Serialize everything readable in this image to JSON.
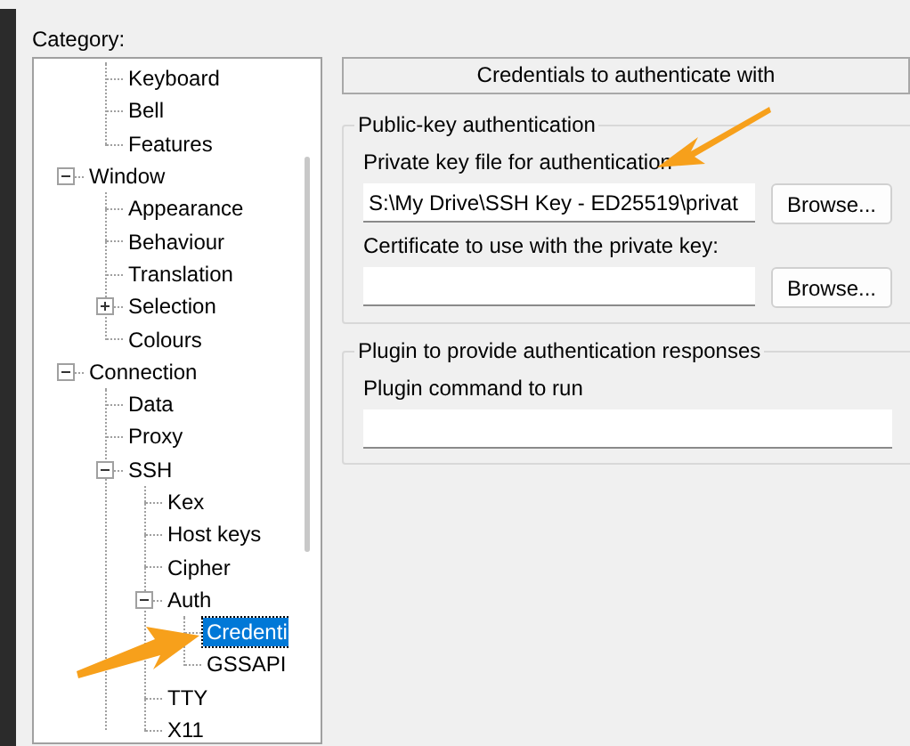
{
  "category_label": "Category:",
  "tree": {
    "items": [
      {
        "children": [
          {
            "label": "Keyboard",
            "selected": false
          },
          {
            "label": "Bell",
            "selected": false
          },
          {
            "label": "Features",
            "selected": false
          }
        ]
      },
      {
        "label": "Window",
        "selected": false,
        "expanded": true,
        "children": [
          {
            "label": "Appearance",
            "selected": false
          },
          {
            "label": "Behaviour",
            "selected": false
          },
          {
            "label": "Translation",
            "selected": false
          },
          {
            "label": "Selection",
            "selected": false,
            "expanded": false
          },
          {
            "label": "Colours",
            "selected": false
          }
        ]
      },
      {
        "label": "Connection",
        "selected": false,
        "expanded": true,
        "children": [
          {
            "label": "Data",
            "selected": false
          },
          {
            "label": "Proxy",
            "selected": false
          },
          {
            "label": "SSH",
            "selected": false,
            "expanded": true,
            "children": [
              {
                "label": "Kex",
                "selected": false
              },
              {
                "label": "Host keys",
                "selected": false
              },
              {
                "label": "Cipher",
                "selected": false
              },
              {
                "label": "Auth",
                "selected": false,
                "expanded": true,
                "children": [
                  {
                    "label": "Credenti",
                    "selected": true
                  },
                  {
                    "label": "GSSAPI",
                    "selected": false
                  }
                ]
              },
              {
                "label": "TTY",
                "selected": false
              },
              {
                "label": "X11",
                "selected": false
              }
            ]
          }
        ]
      }
    ]
  },
  "panel_title": "Credentials to authenticate with",
  "groups": [
    {
      "title": "Public-key authentication",
      "fields": [
        {
          "label": "Private key file for authentication",
          "value": "S:\\My Drive\\SSH Key - ED25519\\privat",
          "button": "Browse..."
        },
        {
          "label": "Certificate to use with the private key:",
          "button": "Browse..."
        }
      ]
    },
    {
      "title": "Plugin to provide authentication responses",
      "fields": [
        {
          "label": "Plugin command to run"
        }
      ]
    }
  ]
}
